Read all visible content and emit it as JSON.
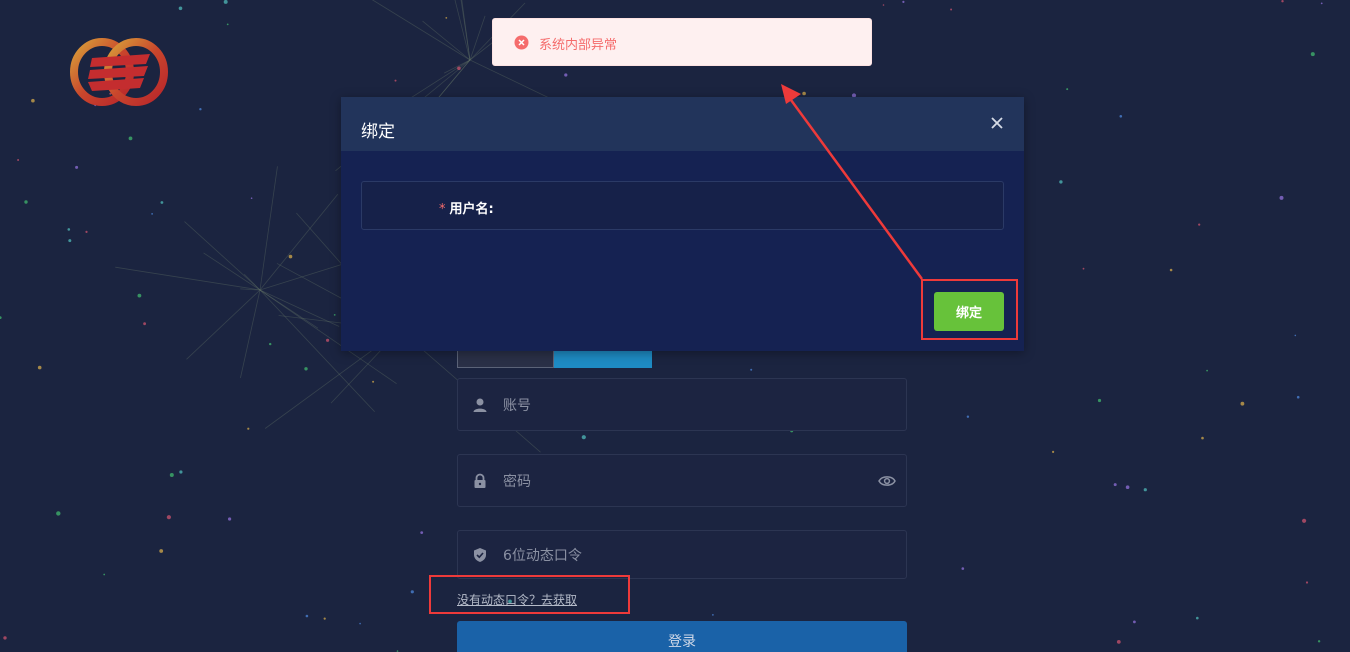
{
  "toast": {
    "message": "系统内部异常",
    "icon": "error-circle-icon",
    "color": "#f56c6c"
  },
  "modal": {
    "title": "绑定",
    "username_required_mark": "*",
    "username_label": "用户名:",
    "bind_button_label": "绑定",
    "close_icon": "close-icon"
  },
  "login": {
    "tabs": [
      "",
      ""
    ],
    "account_placeholder": "账号",
    "password_placeholder": "密码",
    "otp_placeholder": "6位动态口令",
    "get_otp_link": "没有动态口令？去获取",
    "login_button_label": "登录"
  },
  "colors": {
    "background": "#1b2440",
    "bind_button": "#67c23a",
    "login_button": "#1a62a8",
    "active_tab": "#1e8bc4",
    "annotation": "#ee3a3a"
  }
}
